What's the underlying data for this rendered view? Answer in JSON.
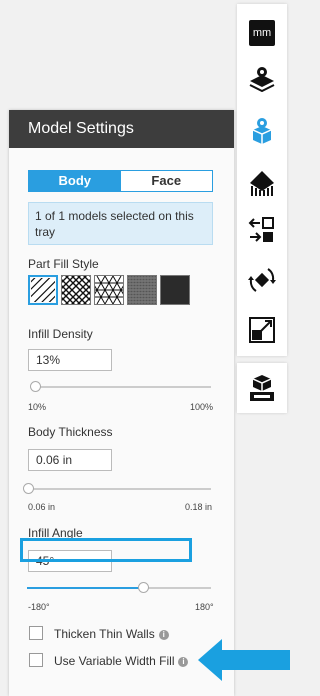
{
  "toolbar": {
    "units_label": "mm",
    "icons": [
      "units-icon",
      "layer-settings-icon",
      "model-settings-icon",
      "support-icon",
      "arrange-icon",
      "rotate-icon",
      "scale-icon",
      "print-queue-icon"
    ]
  },
  "panel": {
    "title": "Model Settings",
    "tabs": {
      "body": "Body",
      "face": "Face"
    },
    "info": "1 of 1 models selected on this tray",
    "part_fill_style_label": "Part Fill Style",
    "infill_density": {
      "label": "Infill Density",
      "value": "13%",
      "min": "10%",
      "max": "100%",
      "fraction": 0.03
    },
    "body_thickness": {
      "label": "Body Thickness",
      "value": "0.06 in",
      "min": "0.06 in",
      "max": "0.18 in",
      "fraction": 0.0
    },
    "infill_angle": {
      "label": "Infill Angle",
      "value": "45°",
      "min": "-180°",
      "max": "180°",
      "fraction": 0.625
    },
    "thicken_thin_walls": "Thicken Thin Walls",
    "use_variable_width_fill": "Use Variable Width Fill"
  },
  "colors": {
    "accent": "#2a9ee0",
    "header": "#3d3d3d",
    "info_bg": "#ddeef9"
  }
}
